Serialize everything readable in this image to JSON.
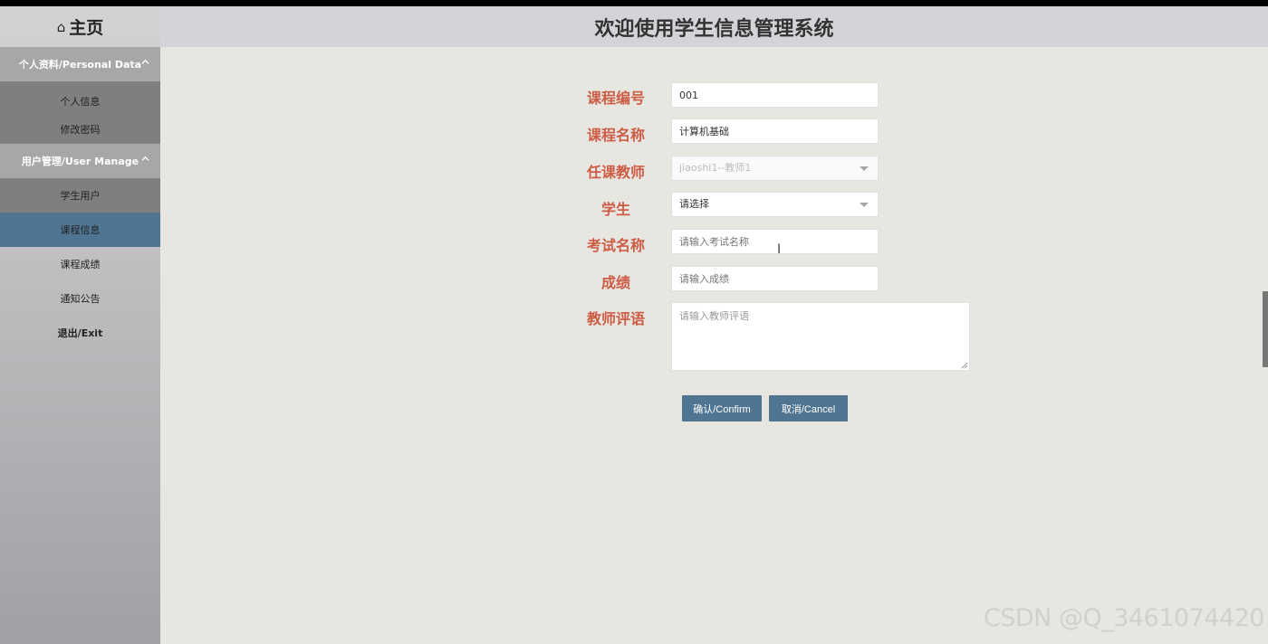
{
  "header": {
    "title": "欢迎使用学生信息管理系统"
  },
  "sidebar": {
    "home": {
      "icon": "home-icon",
      "label": "主页"
    },
    "groups": [
      {
        "label": "个人资料/Personal Data",
        "expanded": true,
        "items": [
          {
            "label": "个人信息"
          },
          {
            "label": "修改密码"
          }
        ]
      },
      {
        "label": "用户管理/User Manage",
        "expanded": true,
        "items": [
          {
            "label": "学生用户"
          }
        ]
      }
    ],
    "items": [
      {
        "label": "课程信息",
        "active": true
      },
      {
        "label": "课程成绩"
      },
      {
        "label": "通知公告"
      },
      {
        "label": "退出/Exit"
      }
    ]
  },
  "form": {
    "course_no": {
      "label": "课程编号",
      "value": "001"
    },
    "course_name": {
      "label": "课程名称",
      "value": "计算机基础"
    },
    "teacher": {
      "label": "任课教师",
      "value": "jiaoshi1--教师1",
      "disabled": true
    },
    "student": {
      "label": "学生",
      "value": "请选择"
    },
    "exam_name": {
      "label": "考试名称",
      "placeholder": "请输入考试名称"
    },
    "score": {
      "label": "成绩",
      "placeholder": "请输入成绩"
    },
    "comment": {
      "label": "教师评语",
      "placeholder": "请输入教师评语"
    },
    "confirm_label": "确认/Confirm",
    "cancel_label": "取消/Cancel"
  },
  "watermark": "CSDN @Q_3461074420",
  "colors": {
    "accent": "#4f7592",
    "label": "#cd5c45",
    "background": "#e7e6e1",
    "header": "#d3d4d7"
  }
}
